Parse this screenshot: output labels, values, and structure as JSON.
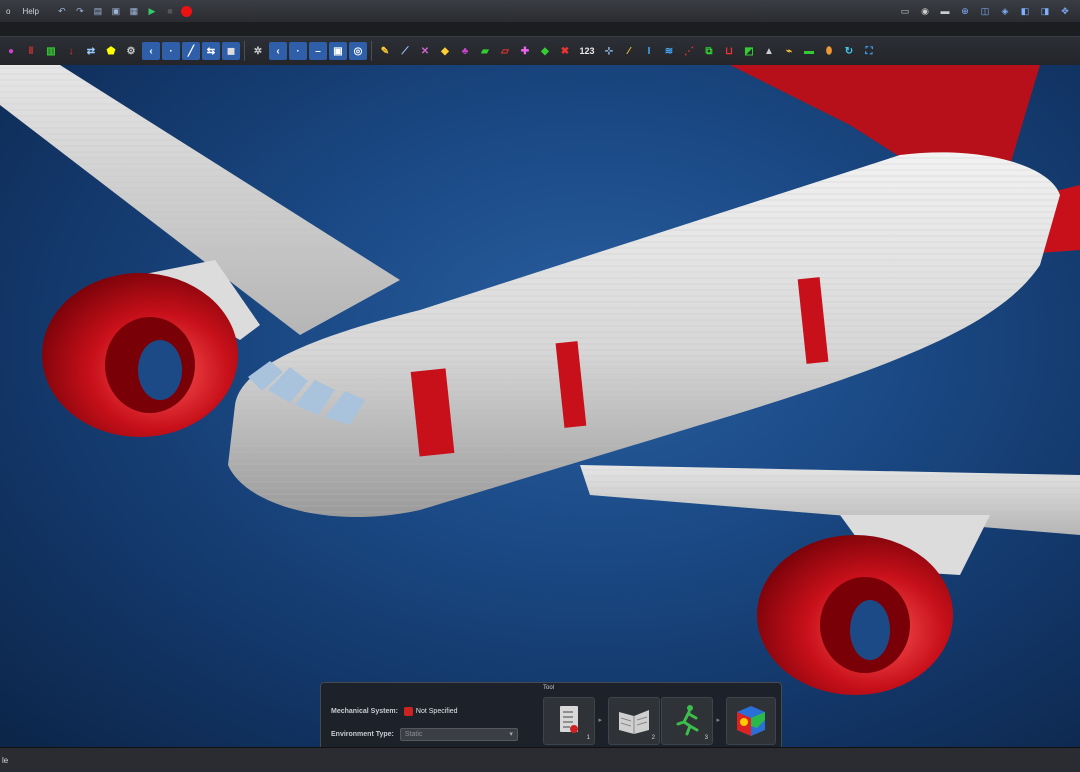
{
  "menubar": {
    "items": [
      "o",
      "Help"
    ]
  },
  "toolbar": {
    "number_tool_label": "123"
  },
  "panel": {
    "tab_label": "Tool",
    "mechanical_system_label": "Mechanical System:",
    "mechanical_system_value": "Not Specified",
    "environment_type_label": "Environment Type:",
    "environment_type_value": "Static",
    "buttons": [
      {
        "name": "checklist",
        "badge": "1"
      },
      {
        "name": "material-book",
        "badge": "2"
      },
      {
        "name": "run-simulation",
        "badge": "3"
      }
    ]
  },
  "statusbar": {
    "text": "le"
  },
  "colors": {
    "accent_red": "#c8101a",
    "viewport_blue": "#1b4a86",
    "fuselage": "#d9d9d9"
  }
}
